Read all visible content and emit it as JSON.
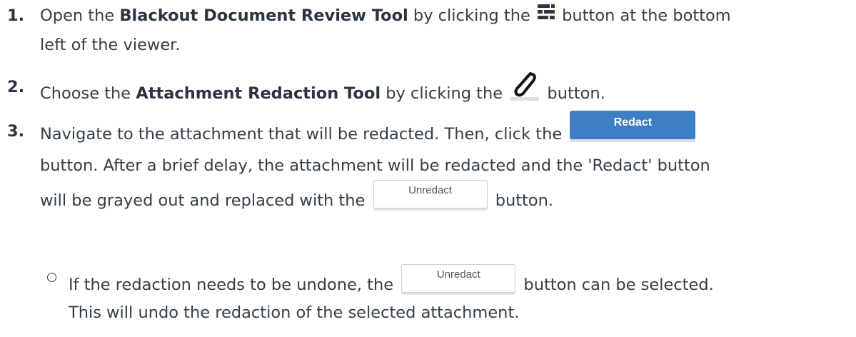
{
  "steps": [
    {
      "number": "1.",
      "before": "Open the ",
      "bold": "Blackout Document Review Tool",
      "after": " by clicking the ",
      "icon": "review-tool-icon",
      "after_icon": " button at the bottom",
      "line2": "left of the viewer."
    },
    {
      "number": "2.",
      "before": "Choose the ",
      "bold": "Attachment Redaction Tool",
      "after": " by clicking the ",
      "icon": "paperclip-icon",
      "after_icon": " button."
    },
    {
      "number": "3.",
      "line1": "Navigate to the attachment that will be redacted. Then, click the",
      "redact_label": "Redact",
      "line2": "button. After a brief delay, the attachment will be redacted and the 'Redact' button",
      "line3_before": "will be grayed out and replaced with the",
      "unredact_label": "Unredact",
      "line3_after": "button."
    }
  ],
  "sub_bullet": {
    "line1_before": "If the redaction needs to be undone, the",
    "unredact_label": "Unredact",
    "line1_after": "button can be selected.",
    "line2": "This will undo the redaction of the selected attachment."
  },
  "colors": {
    "text": "#333e48",
    "redact_button": "#3d7ec4"
  }
}
